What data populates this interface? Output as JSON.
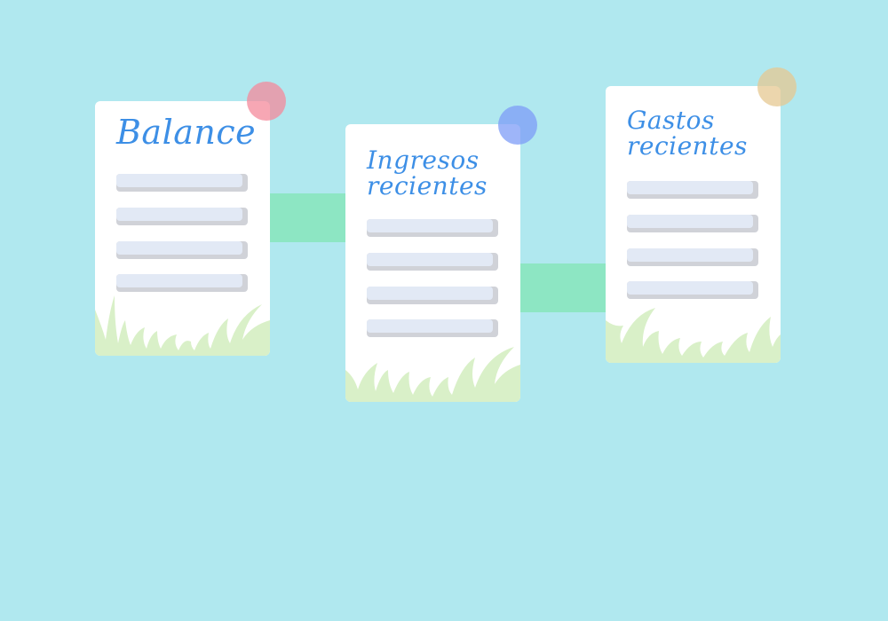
{
  "cards": [
    {
      "title": "Balance",
      "pin_color": "#f48a9b"
    },
    {
      "title": "Ingresos\nrecientes",
      "pin_color": "#7d9cf7"
    },
    {
      "title": "Gastos\nrecientes",
      "pin_color": "#e6c892"
    }
  ],
  "colors": {
    "background": "#b0e8ef",
    "card": "#ffffff",
    "connector": "#8de6c3",
    "title": "#3d8fe6",
    "row": "#e2e9f5",
    "grass": "#d9f0c8"
  }
}
